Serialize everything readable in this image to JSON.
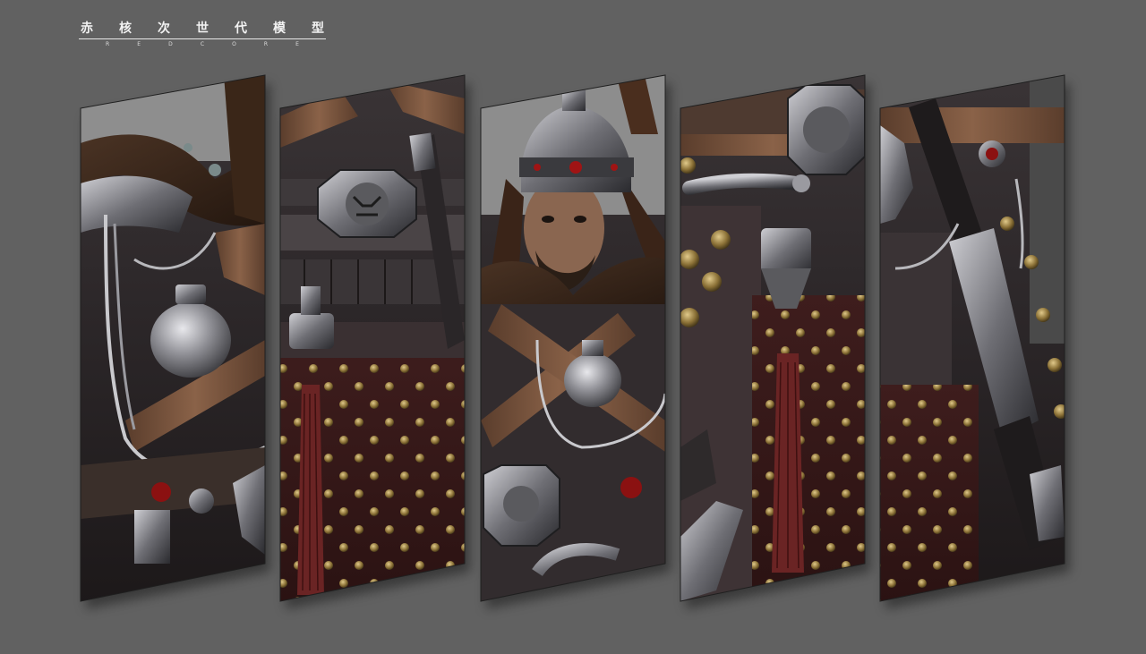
{
  "brand": {
    "name_chars": [
      "赤",
      "核",
      "次",
      "世",
      "代",
      "模",
      "型"
    ],
    "sub_chars": [
      "R",
      "E",
      "D",
      "C",
      "O",
      "R",
      "E"
    ]
  },
  "panels": [
    {
      "subject": "armor-shoulder-chain-detail"
    },
    {
      "subject": "armor-dragon-buckle-detail"
    },
    {
      "subject": "warrior-portrait"
    },
    {
      "subject": "armor-belt-dragon-hilt-detail"
    },
    {
      "subject": "sword-scabbard-detail"
    }
  ],
  "colors": {
    "background": "#616161",
    "armor_dark": "#2e2a2b",
    "leather_brown": "#6a4a36",
    "rivet_brass": "#a88a4a",
    "cloth_red": "#4a1f1f",
    "silver": "#b9b9bd"
  }
}
